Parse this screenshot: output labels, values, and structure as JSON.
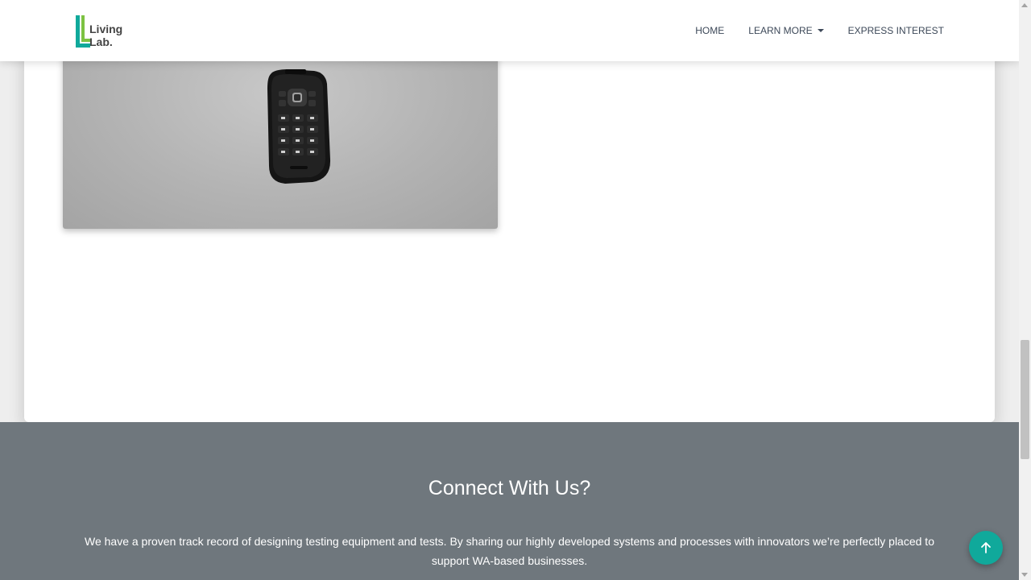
{
  "navbar": {
    "logo_line1": "Living",
    "logo_line2": "Lab.",
    "links": [
      {
        "label": "HOME"
      },
      {
        "label": "LEARN MORE"
      },
      {
        "label": "EXPRESS INTEREST"
      }
    ]
  },
  "main": {
    "image_alt": "black flip phone with lanyard"
  },
  "footer": {
    "title": "Connect With Us?",
    "text": "We have a proven track record of designing testing equipment and tests. By sharing our highly developed systems and processes with innovators we’re perfectly placed to support WA-based businesses."
  },
  "colors": {
    "accent": "#10a99b",
    "logo_green": "#7dc242",
    "footer_bg": "#6f777d"
  },
  "icons": {
    "scroll_top": "arrow-up-icon",
    "dropdown": "caret-down-icon"
  }
}
